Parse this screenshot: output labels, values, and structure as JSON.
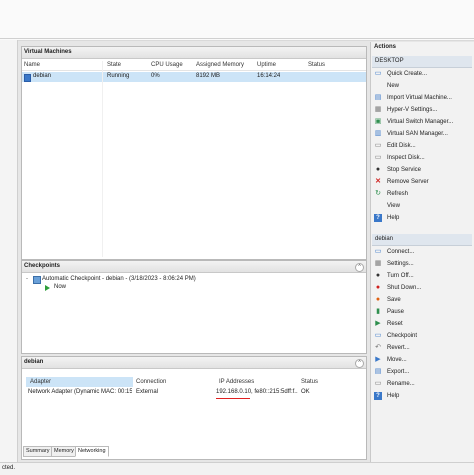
{
  "vm_panel": {
    "title": "Virtual Machines",
    "columns": [
      "Name",
      "State",
      "CPU Usage",
      "Assigned Memory",
      "Uptime",
      "Status"
    ],
    "rows": [
      {
        "name": "debian",
        "state": "Running",
        "cpu": "0%",
        "memory": "8192 MB",
        "uptime": "16:14:24",
        "status": ""
      }
    ]
  },
  "checkpoints": {
    "title": "Checkpoints",
    "items": [
      {
        "label": "Automatic Checkpoint - debian - (3/18/2023 - 8:06:24 PM)"
      },
      {
        "label": "Now"
      }
    ]
  },
  "details": {
    "title": "debian",
    "columns": [
      "Adapter",
      "Connection",
      "IP Addresses",
      "Status"
    ],
    "rows": [
      {
        "adapter": "Network Adapter (Dynamic MAC: 00:15:...",
        "connection": "External",
        "ip": "192.168.0.10, fe80::215:5dff:f...",
        "status": "OK"
      }
    ],
    "tabs": [
      "Summary",
      "Memory",
      "Networking"
    ],
    "active_tab": "Networking"
  },
  "actions": {
    "title": "Actions",
    "host_section": "DESKTOP",
    "host_items": [
      {
        "label": "Quick Create...",
        "icon": "quick-create-icon"
      },
      {
        "label": "New",
        "icon": "new-icon"
      },
      {
        "label": "Import Virtual Machine...",
        "icon": "import-icon"
      },
      {
        "label": "Hyper-V Settings...",
        "icon": "settings-icon"
      },
      {
        "label": "Virtual Switch Manager...",
        "icon": "switch-icon"
      },
      {
        "label": "Virtual SAN Manager...",
        "icon": "san-icon"
      },
      {
        "label": "Edit Disk...",
        "icon": "edit-disk-icon"
      },
      {
        "label": "Inspect Disk...",
        "icon": "inspect-disk-icon"
      },
      {
        "label": "Stop Service",
        "icon": "stop-icon"
      },
      {
        "label": "Remove Server",
        "icon": "remove-icon"
      },
      {
        "label": "Refresh",
        "icon": "refresh-icon"
      },
      {
        "label": "View",
        "icon": "view-icon"
      },
      {
        "label": "Help",
        "icon": "help-icon"
      }
    ],
    "vm_section": "debian",
    "vm_items": [
      {
        "label": "Connect...",
        "icon": "connect-icon"
      },
      {
        "label": "Settings...",
        "icon": "settings-icon"
      },
      {
        "label": "Turn Off...",
        "icon": "turn-off-icon"
      },
      {
        "label": "Shut Down...",
        "icon": "shut-down-icon"
      },
      {
        "label": "Save",
        "icon": "save-icon"
      },
      {
        "label": "Pause",
        "icon": "pause-icon"
      },
      {
        "label": "Reset",
        "icon": "reset-icon"
      },
      {
        "label": "Checkpoint",
        "icon": "checkpoint-icon"
      },
      {
        "label": "Revert...",
        "icon": "revert-icon"
      },
      {
        "label": "Move...",
        "icon": "move-icon"
      },
      {
        "label": "Export...",
        "icon": "export-icon"
      },
      {
        "label": "Rename...",
        "icon": "rename-icon"
      },
      {
        "label": "Help",
        "icon": "help-icon"
      }
    ]
  },
  "status_bar": {
    "text": "cted."
  },
  "colors": {
    "highlight": "#cce4f7",
    "accent": "#0078d7",
    "underline": "#e02020"
  }
}
